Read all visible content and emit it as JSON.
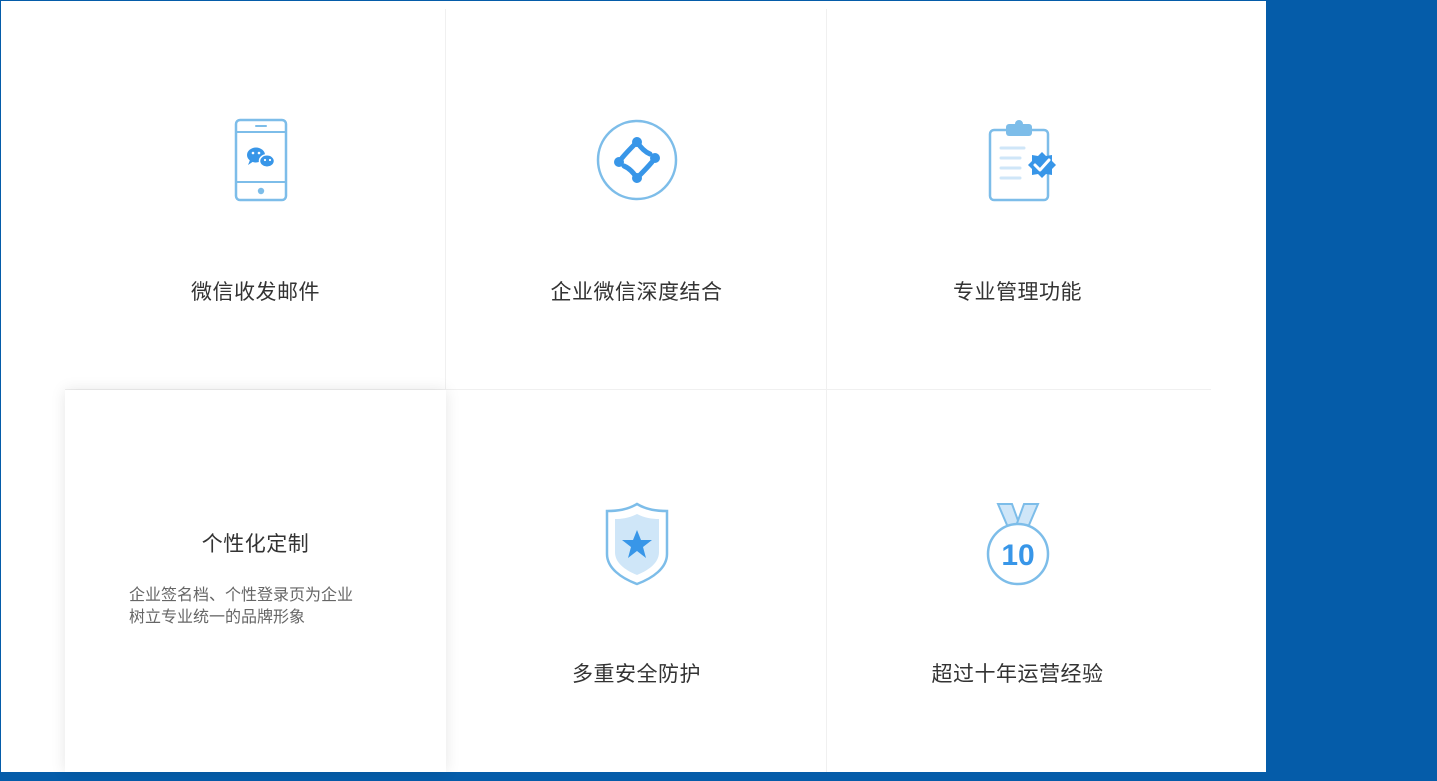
{
  "colors": {
    "background": "#055ca9",
    "panel": "#ffffff",
    "icon_stroke": "#7dbde9",
    "icon_fill": "#3896e8",
    "icon_light": "#cfe6f8",
    "title_text": "#333333",
    "desc_text": "#666666"
  },
  "features": [
    {
      "title": "微信收发邮件",
      "icon": "wechat-phone-icon"
    },
    {
      "title": "企业微信深度结合",
      "icon": "work-wechat-icon"
    },
    {
      "title": "专业管理功能",
      "icon": "clipboard-check-icon"
    },
    {
      "title": "个性化定制",
      "icon": "",
      "desc_line1": "企业签名档、个性登录页为企业",
      "desc_line2": "树立专业统一的品牌形象"
    },
    {
      "title": "多重安全防护",
      "icon": "shield-star-icon"
    },
    {
      "title": "超过十年运营经验",
      "icon": "medal-10-icon",
      "badge": "10"
    }
  ]
}
